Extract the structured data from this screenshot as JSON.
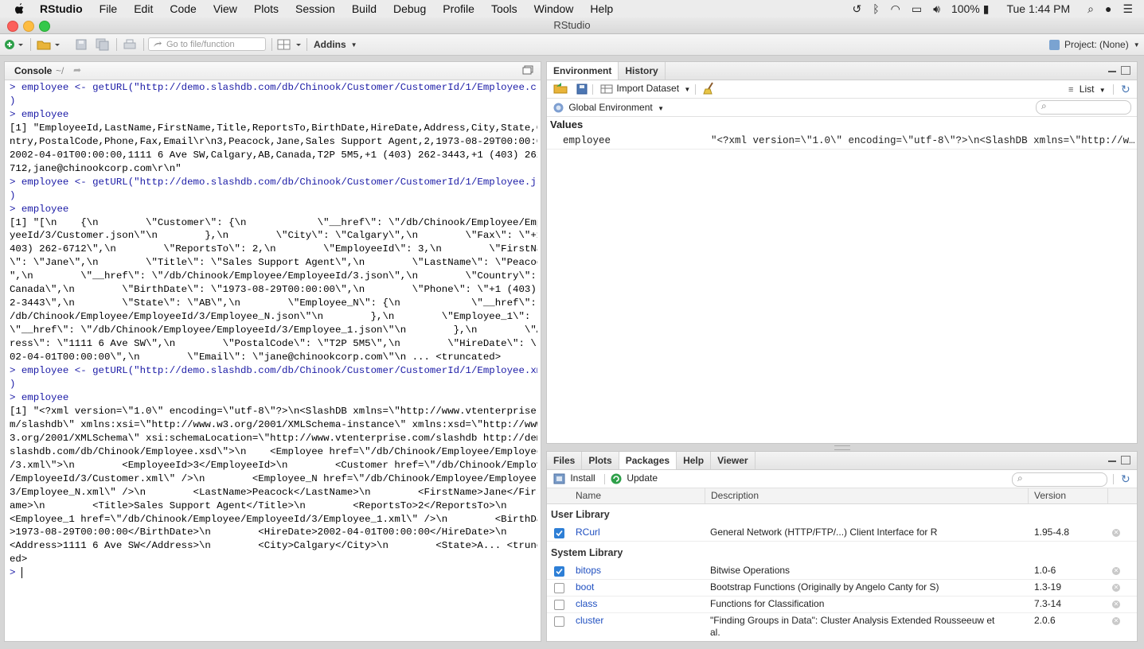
{
  "menubar": {
    "items": [
      "RStudio",
      "File",
      "Edit",
      "Code",
      "View",
      "Plots",
      "Session",
      "Build",
      "Debug",
      "Profile",
      "Tools",
      "Window",
      "Help"
    ],
    "battery": "100%",
    "clock": "Tue 1:44 PM"
  },
  "window": {
    "title": "RStudio"
  },
  "toolbar": {
    "goto_placeholder": "Go to file/function",
    "addins": "Addins",
    "project": "Project: (None)"
  },
  "console": {
    "title": "Console",
    "path": "~/",
    "lines": [
      {
        "t": "cmd",
        "s": "> employee <- getURL(\"http://demo.slashdb.com/db/Chinook/Customer/CustomerId/1/Employee.csv\""
      },
      {
        "t": "cmd",
        "s": ")"
      },
      {
        "t": "cmd",
        "s": "> employee"
      },
      {
        "t": "out",
        "s": "[1] \"EmployeeId,LastName,FirstName,Title,ReportsTo,BirthDate,HireDate,Address,City,State,Cou"
      },
      {
        "t": "out",
        "s": "ntry,PostalCode,Phone,Fax,Email\\r\\n3,Peacock,Jane,Sales Support Agent,2,1973-08-29T00:00:00,"
      },
      {
        "t": "out",
        "s": "2002-04-01T00:00:00,1111 6 Ave SW,Calgary,AB,Canada,T2P 5M5,+1 (403) 262-3443,+1 (403) 262-6"
      },
      {
        "t": "out",
        "s": "712,jane@chinookcorp.com\\r\\n\""
      },
      {
        "t": "cmd",
        "s": "> employee <- getURL(\"http://demo.slashdb.com/db/Chinook/Customer/CustomerId/1/Employee.json\""
      },
      {
        "t": "cmd",
        "s": ")"
      },
      {
        "t": "cmd",
        "s": "> employee"
      },
      {
        "t": "out",
        "s": "[1] \"[\\n    {\\n        \\\"Customer\\\": {\\n            \\\"__href\\\": \\\"/db/Chinook/Employee/Emplo"
      },
      {
        "t": "out",
        "s": "yeeId/3/Customer.json\\\"\\n        },\\n        \\\"City\\\": \\\"Calgary\\\",\\n        \\\"Fax\\\": \\\"+1 ("
      },
      {
        "t": "out",
        "s": "403) 262-6712\\\",\\n        \\\"ReportsTo\\\": 2,\\n        \\\"EmployeeId\\\": 3,\\n        \\\"FirstName"
      },
      {
        "t": "out",
        "s": "\\\": \\\"Jane\\\",\\n        \\\"Title\\\": \\\"Sales Support Agent\\\",\\n        \\\"LastName\\\": \\\"Peacock\\"
      },
      {
        "t": "out",
        "s": "\",\\n        \\\"__href\\\": \\\"/db/Chinook/Employee/EmployeeId/3.json\\\",\\n        \\\"Country\\\": \\\""
      },
      {
        "t": "out",
        "s": "Canada\\\",\\n        \\\"BirthDate\\\": \\\"1973-08-29T00:00:00\\\",\\n        \\\"Phone\\\": \\\"+1 (403) 26"
      },
      {
        "t": "out",
        "s": "2-3443\\\",\\n        \\\"State\\\": \\\"AB\\\",\\n        \\\"Employee_N\\\": {\\n            \\\"__href\\\": \\\""
      },
      {
        "t": "out",
        "s": "/db/Chinook/Employee/EmployeeId/3/Employee_N.json\\\"\\n        },\\n        \\\"Employee_1\\\": {\\n"
      },
      {
        "t": "out",
        "s": "\\\"__href\\\": \\\"/db/Chinook/Employee/EmployeeId/3/Employee_1.json\\\"\\n        },\\n        \\\"Add"
      },
      {
        "t": "out",
        "s": "ress\\\": \\\"1111 6 Ave SW\\\",\\n        \\\"PostalCode\\\": \\\"T2P 5M5\\\",\\n        \\\"HireDate\\\": \\\"20"
      },
      {
        "t": "out",
        "s": "02-04-01T00:00:00\\\",\\n        \\\"Email\\\": \\\"jane@chinookcorp.com\\\"\\n ... <truncated>"
      },
      {
        "t": "cmd",
        "s": "> employee <- getURL(\"http://demo.slashdb.com/db/Chinook/Customer/CustomerId/1/Employee.xml\""
      },
      {
        "t": "cmd",
        "s": ")"
      },
      {
        "t": "cmd",
        "s": "> employee"
      },
      {
        "t": "out",
        "s": "[1] \"<?xml version=\\\"1.0\\\" encoding=\\\"utf-8\\\"?>\\n<SlashDB xmlns=\\\"http://www.vtenterprise.co"
      },
      {
        "t": "out",
        "s": "m/slashdb\\\" xmlns:xsi=\\\"http://www.w3.org/2001/XMLSchema-instance\\\" xmlns:xsd=\\\"http://www.w"
      },
      {
        "t": "out",
        "s": "3.org/2001/XMLSchema\\\" xsi:schemaLocation=\\\"http://www.vtenterprise.com/slashdb http://demo."
      },
      {
        "t": "out",
        "s": "slashdb.com/db/Chinook/Employee.xsd\\\">\\n    <Employee href=\\\"/db/Chinook/Employee/EmployeeId"
      },
      {
        "t": "out",
        "s": "/3.xml\\\">\\n        <EmployeeId>3</EmployeeId>\\n        <Customer href=\\\"/db/Chinook/Employee"
      },
      {
        "t": "out",
        "s": "/EmployeeId/3/Customer.xml\\\" />\\n        <Employee_N href=\\\"/db/Chinook/Employee/EmployeeId/"
      },
      {
        "t": "out",
        "s": "3/Employee_N.xml\\\" />\\n        <LastName>Peacock</LastName>\\n        <FirstName>Jane</FirstN"
      },
      {
        "t": "out",
        "s": "ame>\\n        <Title>Sales Support Agent</Title>\\n        <ReportsTo>2</ReportsTo>\\n"
      },
      {
        "t": "out",
        "s": "<Employee_1 href=\\\"/db/Chinook/Employee/EmployeeId/3/Employee_1.xml\\\" />\\n        <BirthDate"
      },
      {
        "t": "out",
        "s": ">1973-08-29T00:00:00</BirthDate>\\n        <HireDate>2002-04-01T00:00:00</HireDate>\\n"
      },
      {
        "t": "out",
        "s": "<Address>1111 6 Ave SW</Address>\\n        <City>Calgary</City>\\n        <State>A... <truncat"
      },
      {
        "t": "out",
        "s": "ed>"
      },
      {
        "t": "cmd",
        "s": "> "
      }
    ]
  },
  "environment": {
    "tabs": [
      "Environment",
      "History"
    ],
    "import_dataset": "Import Dataset",
    "view_mode": "List",
    "scope": "Global Environment",
    "section": "Values",
    "var_name": "employee",
    "var_value": "\"<?xml version=\\\"1.0\\\" encoding=\\\"utf-8\\\"?>\\n<SlashDB xmlns=\\\"http://w…"
  },
  "packages": {
    "tabs": [
      "Files",
      "Plots",
      "Packages",
      "Help",
      "Viewer"
    ],
    "install": "Install",
    "update": "Update",
    "headers": {
      "name": "Name",
      "description": "Description",
      "version": "Version"
    },
    "user_library_label": "User Library",
    "system_library_label": "System Library",
    "user": [
      {
        "name": "RCurl",
        "desc": "General Network (HTTP/FTP/...) Client Interface for R",
        "version": "1.95-4.8",
        "checked": true
      }
    ],
    "system": [
      {
        "name": "bitops",
        "desc": "Bitwise Operations",
        "version": "1.0-6",
        "checked": true
      },
      {
        "name": "boot",
        "desc": "Bootstrap Functions (Originally by Angelo Canty for S)",
        "version": "1.3-19",
        "checked": false
      },
      {
        "name": "class",
        "desc": "Functions for Classification",
        "version": "7.3-14",
        "checked": false
      },
      {
        "name": "cluster",
        "desc": "\"Finding Groups in Data\": Cluster Analysis Extended Rousseeuw et",
        "desc2": "al.",
        "version": "2.0.6",
        "checked": false
      }
    ]
  }
}
